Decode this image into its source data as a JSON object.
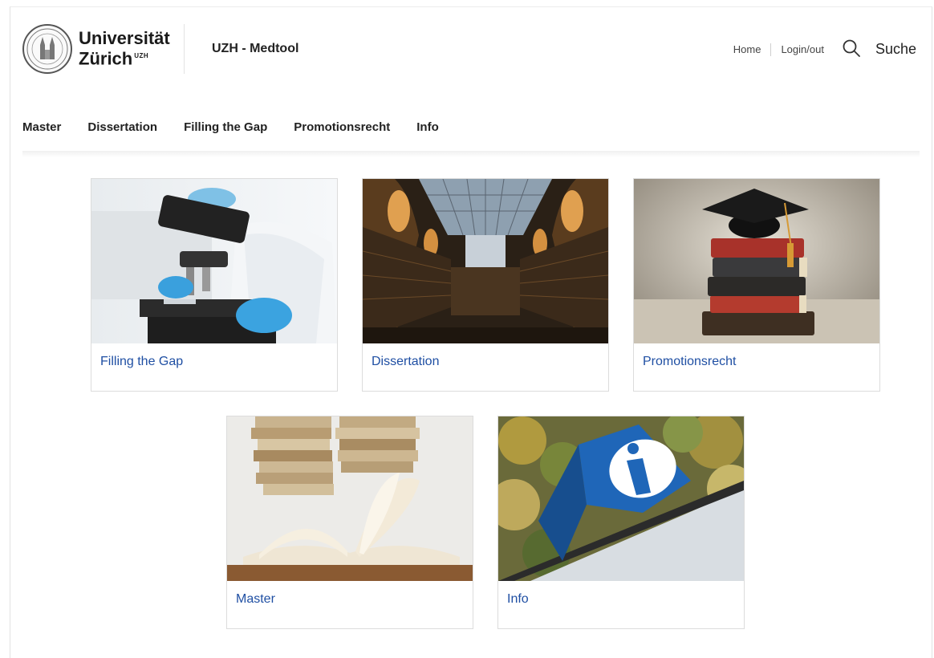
{
  "header": {
    "logo_line1": "Universität",
    "logo_line2": "Zürich",
    "logo_sup": "UZH",
    "app_title": "UZH - Medtool",
    "links": {
      "home": "Home",
      "login": "Login/out"
    },
    "search_label": "Suche"
  },
  "nav": [
    {
      "label": "Master"
    },
    {
      "label": "Dissertation"
    },
    {
      "label": "Filling the Gap"
    },
    {
      "label": "Promotionsrecht"
    },
    {
      "label": "Info"
    }
  ],
  "cards": [
    {
      "label": "Filling the Gap",
      "image": "microscope-lab"
    },
    {
      "label": "Dissertation",
      "image": "library-hall"
    },
    {
      "label": "Promotionsrecht",
      "image": "books-graduation-cap"
    },
    {
      "label": "Master",
      "image": "open-book-stack"
    },
    {
      "label": "Info",
      "image": "info-sign"
    }
  ],
  "colors": {
    "link": "#1f4fa3",
    "text": "#1a1a1a"
  }
}
